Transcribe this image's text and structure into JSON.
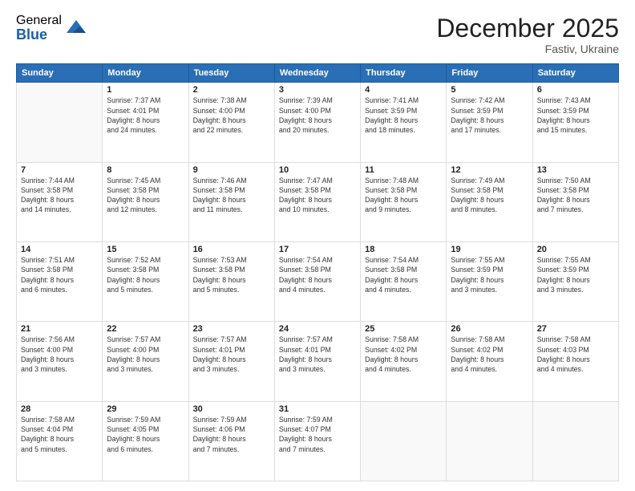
{
  "logo": {
    "general": "General",
    "blue": "Blue"
  },
  "title": "December 2025",
  "subtitle": "Fastiv, Ukraine",
  "days_of_week": [
    "Sunday",
    "Monday",
    "Tuesday",
    "Wednesday",
    "Thursday",
    "Friday",
    "Saturday"
  ],
  "weeks": [
    [
      {
        "day": "",
        "info": ""
      },
      {
        "day": "1",
        "info": "Sunrise: 7:37 AM\nSunset: 4:01 PM\nDaylight: 8 hours\nand 24 minutes."
      },
      {
        "day": "2",
        "info": "Sunrise: 7:38 AM\nSunset: 4:00 PM\nDaylight: 8 hours\nand 22 minutes."
      },
      {
        "day": "3",
        "info": "Sunrise: 7:39 AM\nSunset: 4:00 PM\nDaylight: 8 hours\nand 20 minutes."
      },
      {
        "day": "4",
        "info": "Sunrise: 7:41 AM\nSunset: 3:59 PM\nDaylight: 8 hours\nand 18 minutes."
      },
      {
        "day": "5",
        "info": "Sunrise: 7:42 AM\nSunset: 3:59 PM\nDaylight: 8 hours\nand 17 minutes."
      },
      {
        "day": "6",
        "info": "Sunrise: 7:43 AM\nSunset: 3:59 PM\nDaylight: 8 hours\nand 15 minutes."
      }
    ],
    [
      {
        "day": "7",
        "info": "Sunrise: 7:44 AM\nSunset: 3:58 PM\nDaylight: 8 hours\nand 14 minutes."
      },
      {
        "day": "8",
        "info": "Sunrise: 7:45 AM\nSunset: 3:58 PM\nDaylight: 8 hours\nand 12 minutes."
      },
      {
        "day": "9",
        "info": "Sunrise: 7:46 AM\nSunset: 3:58 PM\nDaylight: 8 hours\nand 11 minutes."
      },
      {
        "day": "10",
        "info": "Sunrise: 7:47 AM\nSunset: 3:58 PM\nDaylight: 8 hours\nand 10 minutes."
      },
      {
        "day": "11",
        "info": "Sunrise: 7:48 AM\nSunset: 3:58 PM\nDaylight: 8 hours\nand 9 minutes."
      },
      {
        "day": "12",
        "info": "Sunrise: 7:49 AM\nSunset: 3:58 PM\nDaylight: 8 hours\nand 8 minutes."
      },
      {
        "day": "13",
        "info": "Sunrise: 7:50 AM\nSunset: 3:58 PM\nDaylight: 8 hours\nand 7 minutes."
      }
    ],
    [
      {
        "day": "14",
        "info": "Sunrise: 7:51 AM\nSunset: 3:58 PM\nDaylight: 8 hours\nand 6 minutes."
      },
      {
        "day": "15",
        "info": "Sunrise: 7:52 AM\nSunset: 3:58 PM\nDaylight: 8 hours\nand 5 minutes."
      },
      {
        "day": "16",
        "info": "Sunrise: 7:53 AM\nSunset: 3:58 PM\nDaylight: 8 hours\nand 5 minutes."
      },
      {
        "day": "17",
        "info": "Sunrise: 7:54 AM\nSunset: 3:58 PM\nDaylight: 8 hours\nand 4 minutes."
      },
      {
        "day": "18",
        "info": "Sunrise: 7:54 AM\nSunset: 3:58 PM\nDaylight: 8 hours\nand 4 minutes."
      },
      {
        "day": "19",
        "info": "Sunrise: 7:55 AM\nSunset: 3:59 PM\nDaylight: 8 hours\nand 3 minutes."
      },
      {
        "day": "20",
        "info": "Sunrise: 7:55 AM\nSunset: 3:59 PM\nDaylight: 8 hours\nand 3 minutes."
      }
    ],
    [
      {
        "day": "21",
        "info": "Sunrise: 7:56 AM\nSunset: 4:00 PM\nDaylight: 8 hours\nand 3 minutes."
      },
      {
        "day": "22",
        "info": "Sunrise: 7:57 AM\nSunset: 4:00 PM\nDaylight: 8 hours\nand 3 minutes."
      },
      {
        "day": "23",
        "info": "Sunrise: 7:57 AM\nSunset: 4:01 PM\nDaylight: 8 hours\nand 3 minutes."
      },
      {
        "day": "24",
        "info": "Sunrise: 7:57 AM\nSunset: 4:01 PM\nDaylight: 8 hours\nand 3 minutes."
      },
      {
        "day": "25",
        "info": "Sunrise: 7:58 AM\nSunset: 4:02 PM\nDaylight: 8 hours\nand 4 minutes."
      },
      {
        "day": "26",
        "info": "Sunrise: 7:58 AM\nSunset: 4:02 PM\nDaylight: 8 hours\nand 4 minutes."
      },
      {
        "day": "27",
        "info": "Sunrise: 7:58 AM\nSunset: 4:03 PM\nDaylight: 8 hours\nand 4 minutes."
      }
    ],
    [
      {
        "day": "28",
        "info": "Sunrise: 7:58 AM\nSunset: 4:04 PM\nDaylight: 8 hours\nand 5 minutes."
      },
      {
        "day": "29",
        "info": "Sunrise: 7:59 AM\nSunset: 4:05 PM\nDaylight: 8 hours\nand 6 minutes."
      },
      {
        "day": "30",
        "info": "Sunrise: 7:59 AM\nSunset: 4:06 PM\nDaylight: 8 hours\nand 7 minutes."
      },
      {
        "day": "31",
        "info": "Sunrise: 7:59 AM\nSunset: 4:07 PM\nDaylight: 8 hours\nand 7 minutes."
      },
      {
        "day": "",
        "info": ""
      },
      {
        "day": "",
        "info": ""
      },
      {
        "day": "",
        "info": ""
      }
    ]
  ]
}
